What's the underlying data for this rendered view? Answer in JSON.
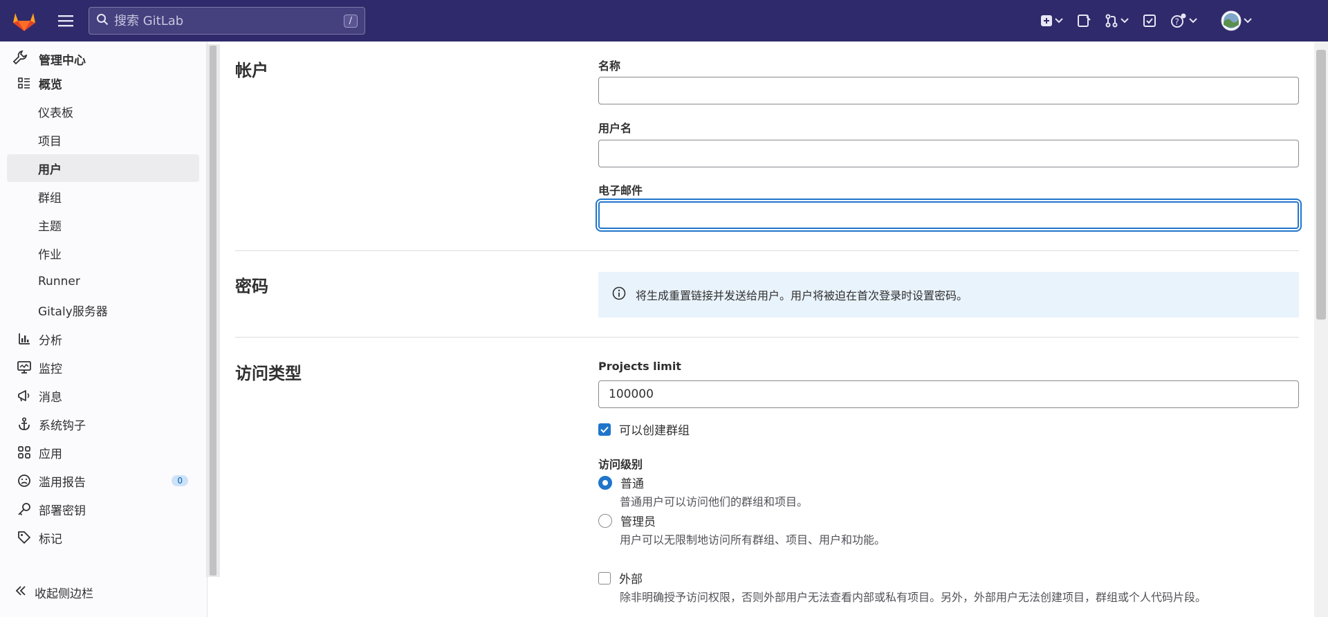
{
  "topbar": {
    "search_placeholder": "搜索 GitLab",
    "search_shortcut": "/"
  },
  "sidebar": {
    "header": "管理中心",
    "items": [
      {
        "label": "概览",
        "icon": "overview-icon"
      },
      {
        "label": "仪表板"
      },
      {
        "label": "项目"
      },
      {
        "label": "用户",
        "active": true
      },
      {
        "label": "群组"
      },
      {
        "label": "主题"
      },
      {
        "label": "作业"
      },
      {
        "label": "Runner"
      },
      {
        "label": "Gitaly服务器"
      },
      {
        "label": "分析",
        "icon": "analytics-icon"
      },
      {
        "label": "监控",
        "icon": "monitor-icon"
      },
      {
        "label": "消息",
        "icon": "messages-icon"
      },
      {
        "label": "系统钩子",
        "icon": "hook-icon"
      },
      {
        "label": "应用",
        "icon": "applications-icon"
      },
      {
        "label": "滥用报告",
        "icon": "abuse-icon",
        "badge": "0"
      },
      {
        "label": "部署密钥",
        "icon": "key-icon"
      },
      {
        "label": "标记",
        "icon": "label-icon"
      }
    ],
    "collapse_label": "收起侧边栏"
  },
  "account": {
    "title": "帐户",
    "name_label": "名称",
    "name_value": "",
    "username_label": "用户名",
    "username_value": "",
    "email_label": "电子邮件",
    "email_value": ""
  },
  "password": {
    "title": "密码",
    "info": "将生成重置链接并发送给用户。用户将被迫在首次登录时设置密码。"
  },
  "access": {
    "title": "访问类型",
    "projects_limit_label": "Projects limit",
    "projects_limit_value": "100000",
    "can_create_group_label": "可以创建群组",
    "can_create_group": true,
    "access_level_label": "访问级别",
    "levels": [
      {
        "label": "普通",
        "help": "普通用户可以访问他们的群组和项目。",
        "selected": true
      },
      {
        "label": "管理员",
        "help": "用户可以无限制地访问所有群组、项目、用户和功能。",
        "selected": false
      }
    ],
    "external_label": "外部",
    "external_checked": false,
    "external_help": "除非明确授予访问权限，否则外部用户无法查看内部或私有项目。另外，外部用户无法创建项目，群组或个人代码片段。"
  },
  "colors": {
    "topbar": "#2f2a6b",
    "accent": "#1f75cb",
    "info_bg": "#e9f3fc"
  }
}
